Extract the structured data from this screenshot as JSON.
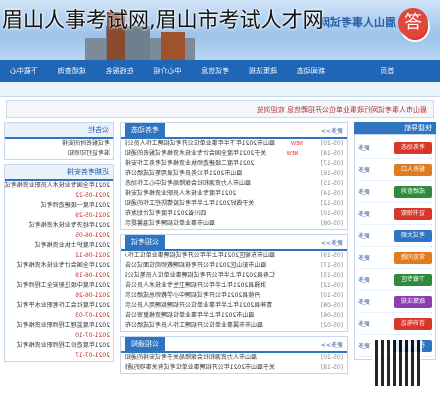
{
  "watermark": {
    "title": "眉山人事考试网,眉山市考试人才网",
    "logo_char": "答"
  },
  "banner": {
    "site_name": "眉山人事考试网"
  },
  "nav": {
    "items": [
      "首页",
      "新闻动态",
      "政策法规",
      "考试信息",
      "中心介绍",
      "在线报名",
      "成绩查询",
      "下载中心"
    ]
  },
  "notice": {
    "text": "眉山市人事考试网行政事业单位公开招聘信息 欢迎浏览"
  },
  "sidebar": {
    "header": "快捷导航",
    "items": [
      {
        "label": "考务动态",
        "more": "更多"
      },
      {
        "label": "报名入口",
        "more": "更多"
      },
      {
        "label": "成绩查询",
        "more": "更多"
      },
      {
        "label": "证书领取",
        "more": "更多"
      },
      {
        "label": "考试大纲",
        "more": "更多"
      },
      {
        "label": "常见问题",
        "more": "更多"
      },
      {
        "label": "下载专区",
        "more": "更多"
      },
      {
        "label": "政策法规",
        "more": "更多"
      },
      {
        "label": "咨询电话",
        "more": "更多"
      },
      {
        "label": "在线留言",
        "more": "更多"
      }
    ],
    "chip_colors": [
      "#d8352b",
      "#e07b1f",
      "#2e8b3d",
      "#d8352b",
      "#2f74c0",
      "#e07b1f",
      "#2e8b3d",
      "#8a3fb0",
      "#d8352b",
      "#2f74c0"
    ]
  },
  "main": {
    "panels": [
      {
        "tab": "考务动态",
        "more": "更多>>",
        "rows": [
          {
            "t": "眉山市2021年下半年事业单位公开考试招聘工作人员公告",
            "d": "[05-20]",
            "new": "NEW"
          },
          {
            "t": "关于2021年度全国会计专业技术资格考试报名的通知",
            "d": "[05-18]",
            "new": "NEW"
          },
          {
            "t": "2021年度二级建造师执业资格考试考务工作安排",
            "d": "[05-17]",
            "new": ""
          },
          {
            "t": "眉山市2021年公务员考试录用笔试成绩公布",
            "d": "[05-16]",
            "new": ""
          },
          {
            "t": "眉山市人力资源和社会保障局考试中心工作动态",
            "d": "[05-15]",
            "new": ""
          },
          {
            "t": "2021年度专业技术人员职业资格考试安排",
            "d": "[05-14]",
            "new": ""
          },
          {
            "t": "关于做好2021年上半年考试疫情防控工作的通知",
            "d": "[05-12]",
            "new": ""
          },
          {
            "t": "四川省2021年度考试计划发布",
            "d": "[05-10]",
            "new": ""
          },
          {
            "t": "眉山市事业单位招聘考试温馨提示",
            "d": "[05-08]",
            "new": ""
          }
        ]
      },
      {
        "tab": "公招考试",
        "more": "更多>>",
        "rows": [
          {
            "t": "眉山市东坡区2021年上半年公开考试招聘事业单位工作人员公告",
            "d": "[05-19]",
            "new": ""
          },
          {
            "t": "眉山市彭山区2021年公开考核招聘教师岗位面试公告",
            "d": "[05-17]",
            "new": ""
          },
          {
            "t": "仁寿县2021年上半年公开考试招聘事业单位人员笔试公告",
            "d": "[05-15]",
            "new": ""
          },
          {
            "t": "洪雅县2021年上半年公开招聘卫生专业技术人员公告",
            "d": "[05-12]",
            "new": ""
          },
          {
            "t": "丹棱县2021年公开考试招聘中小学教师总成绩公示",
            "d": "[05-10]",
            "new": ""
          },
          {
            "t": "青神县2021年上半年事业单位公开招聘拟聘用人员公示",
            "d": "[05-08]",
            "new": ""
          },
          {
            "t": "眉山市2021年上半年事业单位招聘资格复审公告",
            "d": "[05-06]",
            "new": ""
          },
          {
            "t": "眉山市市属事业单位公开招聘工作人员考试成绩公布",
            "d": "[05-02]",
            "new": ""
          }
        ]
      },
      {
        "tab": "公招通知",
        "more": "更多>>",
        "rows": [
          {
            "t": "眉山市人力资源和社会保障局关于考试安排的通知",
            "d": "[05-20]",
            "new": ""
          },
          {
            "t": "关于眉山市2021年公开招聘事业单位考试有关事项的通知",
            "d": "[05-18]",
            "new": ""
          }
        ]
      }
    ]
  },
  "right": {
    "boxes": [
      {
        "head": "公告栏",
        "rows": [
          "考试报名时间安排",
          "准考证打印须知"
        ]
      },
      {
        "head": "近期考务安排",
        "rows": [
          {
            "t": "2021年全国专业技术人员职业资格考试",
            "d": "2021-05-22"
          },
          {
            "t": "2021年度一级建造师考试",
            "d": "2021-05-29"
          },
          {
            "t": "2021年经济专业技术资格考试",
            "d": "2021-06-05"
          },
          {
            "t": "2021年度护士执业资格考试",
            "d": "2021-06-12"
          },
          {
            "t": "2021年全国会计专业技术资格考试",
            "d": "2021-06-19"
          },
          {
            "t": "2021年度中级注册安全工程师考试",
            "d": "2021-06-26"
          },
          {
            "t": "2021年度社会工作者职业水平考试",
            "d": "2021-07-03"
          },
          {
            "t": "2021年度监理工程师职业资格考试",
            "d": "2021-07-10"
          },
          {
            "t": "2021年度造价工程师职业资格考试",
            "d": "2021-07-17"
          }
        ]
      }
    ]
  }
}
